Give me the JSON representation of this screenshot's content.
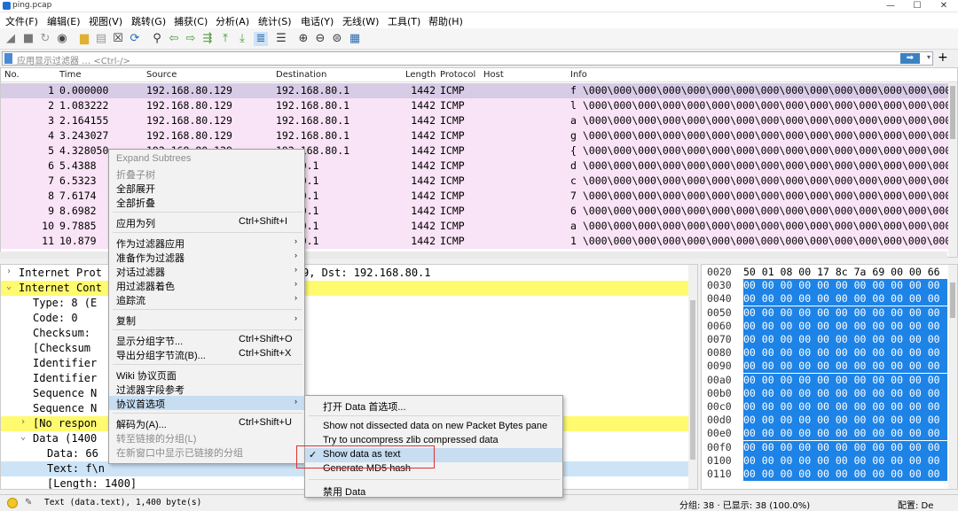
{
  "window": {
    "title": "ping.pcap",
    "minimize": "—",
    "maximize": "☐",
    "close": "✕"
  },
  "menubar": [
    "文件(F)",
    "编辑(E)",
    "视图(V)",
    "跳转(G)",
    "捕获(C)",
    "分析(A)",
    "统计(S)",
    "电话(Y)",
    "无线(W)",
    "工具(T)",
    "帮助(H)"
  ],
  "toolbar_icons": [
    "shark-fin-start-icon",
    "stop-icon",
    "restart-icon",
    "options-icon",
    "open-folder-icon",
    "save-file-icon",
    "close-file-icon",
    "reload-icon",
    "find-icon",
    "back-arrow-icon",
    "forward-arrow-icon",
    "goto-packet-icon",
    "first-packet-icon",
    "last-packet-icon",
    "autoscroll-icon",
    "colorize-icon",
    "zoom-in-icon",
    "zoom-out-icon",
    "zoom-normal-icon",
    "resize-columns-icon"
  ],
  "filter": {
    "placeholder": "应用显示过滤器 … <Ctrl-/>",
    "apply_arrow": "➡",
    "dropdown": "▾",
    "add": "+"
  },
  "packet_list": {
    "columns": [
      "No.",
      "Time",
      "Source",
      "Destination",
      "Length",
      "Protocol",
      "Host",
      "Info"
    ],
    "rows": [
      {
        "no": "1",
        "time": "0.000000",
        "src": "192.168.80.129",
        "dst": "192.168.80.1",
        "len": "1442",
        "proto": "ICMP",
        "info": "f \\000\\000\\000\\000\\000\\000\\000\\000\\000\\000\\000\\000\\000\\000\\000\\000\\000\\000\\000\\000\\000\\000"
      },
      {
        "no": "2",
        "time": "1.083222",
        "src": "192.168.80.129",
        "dst": "192.168.80.1",
        "len": "1442",
        "proto": "ICMP",
        "info": "l \\000\\000\\000\\000\\000\\000\\000\\000\\000\\000\\000\\000\\000\\000\\000\\000\\000\\000\\000\\000\\000\\000"
      },
      {
        "no": "3",
        "time": "2.164155",
        "src": "192.168.80.129",
        "dst": "192.168.80.1",
        "len": "1442",
        "proto": "ICMP",
        "info": "a \\000\\000\\000\\000\\000\\000\\000\\000\\000\\000\\000\\000\\000\\000\\000\\000\\000\\000\\000\\000\\000\\000"
      },
      {
        "no": "4",
        "time": "3.243027",
        "src": "192.168.80.129",
        "dst": "192.168.80.1",
        "len": "1442",
        "proto": "ICMP",
        "info": "g \\000\\000\\000\\000\\000\\000\\000\\000\\000\\000\\000\\000\\000\\000\\000\\000\\000\\000\\000\\000\\000\\000"
      },
      {
        "no": "5",
        "time": "4.328050",
        "src": "192.168.80.129",
        "dst": "192.168.80.1",
        "len": "1442",
        "proto": "ICMP",
        "info": "{ \\000\\000\\000\\000\\000\\000\\000\\000\\000\\000\\000\\000\\000\\000\\000\\000\\000\\000\\000\\000\\000\\000"
      },
      {
        "no": "6",
        "time": "5.4388",
        "src": "",
        "dst": "58.80.1",
        "len": "1442",
        "proto": "ICMP",
        "info": "d \\000\\000\\000\\000\\000\\000\\000\\000\\000\\000\\000\\000\\000\\000\\000\\000\\000\\000\\000\\000\\000\\000"
      },
      {
        "no": "7",
        "time": "6.5323",
        "src": "",
        "dst": "58.80.1",
        "len": "1442",
        "proto": "ICMP",
        "info": "c \\000\\000\\000\\000\\000\\000\\000\\000\\000\\000\\000\\000\\000\\000\\000\\000\\000\\000\\000\\000\\000\\000"
      },
      {
        "no": "8",
        "time": "7.6174",
        "src": "",
        "dst": "58.80.1",
        "len": "1442",
        "proto": "ICMP",
        "info": "7 \\000\\000\\000\\000\\000\\000\\000\\000\\000\\000\\000\\000\\000\\000\\000\\000\\000\\000\\000\\000\\000\\000"
      },
      {
        "no": "9",
        "time": "8.6982",
        "src": "",
        "dst": "58.80.1",
        "len": "1442",
        "proto": "ICMP",
        "info": "6 \\000\\000\\000\\000\\000\\000\\000\\000\\000\\000\\000\\000\\000\\000\\000\\000\\000\\000\\000\\000\\000\\000"
      },
      {
        "no": "10",
        "time": "9.7885",
        "src": "",
        "dst": "58.80.1",
        "len": "1442",
        "proto": "ICMP",
        "info": "a \\000\\000\\000\\000\\000\\000\\000\\000\\000\\000\\000\\000\\000\\000\\000\\000\\000\\000\\000\\000\\000\\000"
      },
      {
        "no": "11",
        "time": "10.879",
        "src": "",
        "dst": "58.80.1",
        "len": "1442",
        "proto": "ICMP",
        "info": "1 \\000\\000\\000\\000\\000\\000\\000\\000\\000\\000\\000\\000\\000\\000\\000\\000\\000\\000\\000\\000\\000\\000"
      }
    ]
  },
  "details": {
    "rows": [
      {
        "arrow": "›",
        "text": "Internet Prot",
        "extra": "9, Dst: 192.168.80.1"
      },
      {
        "arrow": "⌄",
        "text": "Internet Cont",
        "extra": ""
      },
      {
        "arrow": "",
        "text": "Type: 8 (E",
        "extra": ""
      },
      {
        "arrow": "",
        "text": "Code: 0",
        "extra": ""
      },
      {
        "arrow": "",
        "text": "Checksum:",
        "extra": ""
      },
      {
        "arrow": "",
        "text": "[Checksum",
        "extra": ""
      },
      {
        "arrow": "",
        "text": "Identifier",
        "extra": ""
      },
      {
        "arrow": "",
        "text": "Identifier",
        "extra": ""
      },
      {
        "arrow": "",
        "text": "Sequence N",
        "extra": ""
      },
      {
        "arrow": "",
        "text": "Sequence N",
        "extra": ""
      },
      {
        "arrow": "›",
        "text": "[No respon",
        "extra": ""
      },
      {
        "arrow": "⌄",
        "text": "Data (1400",
        "extra": ""
      },
      {
        "arrow": "",
        "text": "Data: 66",
        "extra": ""
      },
      {
        "arrow": "",
        "text": "Text: f\\n",
        "extra": ""
      },
      {
        "arrow": "",
        "text": "[Length: 1400]",
        "extra": ""
      }
    ]
  },
  "bytes": {
    "rows": [
      {
        "off": "0020",
        "hex": "50 01 08 00 17 8c 7a 69  00 00 66"
      },
      {
        "off": "0030",
        "hex": "00 00 00 00 00 00 00 00  00 00 00"
      },
      {
        "off": "0040",
        "hex": "00 00 00 00 00 00 00 00  00 00 00"
      },
      {
        "off": "0050",
        "hex": "00 00 00 00 00 00 00 00  00 00 00"
      },
      {
        "off": "0060",
        "hex": "00 00 00 00 00 00 00 00  00 00 00"
      },
      {
        "off": "0070",
        "hex": "00 00 00 00 00 00 00 00  00 00 00"
      },
      {
        "off": "0080",
        "hex": "00 00 00 00 00 00 00 00  00 00 00"
      },
      {
        "off": "0090",
        "hex": "00 00 00 00 00 00 00 00  00 00 00"
      },
      {
        "off": "00a0",
        "hex": "00 00 00 00 00 00 00 00  00 00 00"
      },
      {
        "off": "00b0",
        "hex": "00 00 00 00 00 00 00 00  00 00 00"
      },
      {
        "off": "00c0",
        "hex": "00 00 00 00 00 00 00 00  00 00 00"
      },
      {
        "off": "00d0",
        "hex": "00 00 00 00 00 00 00 00  00 00 00"
      },
      {
        "off": "00e0",
        "hex": "00 00 00 00 00 00 00 00  00 00 00"
      },
      {
        "off": "00f0",
        "hex": "00 00 00 00 00 00 00 00  00 00 00"
      },
      {
        "off": "0100",
        "hex": "00 00 00 00 00 00 00 00  00 00 00"
      },
      {
        "off": "0110",
        "hex": "00 00 00 00 00 00 00 00  00 00 00"
      }
    ]
  },
  "context_menu": {
    "items": [
      {
        "label": "Expand Subtrees",
        "disabled": true
      },
      {
        "label": "折叠子树",
        "disabled": true
      },
      {
        "label": "全部展开"
      },
      {
        "label": "全部折叠"
      },
      {
        "sep": true
      },
      {
        "label": "应用为列",
        "shortcut": "Ctrl+Shift+I"
      },
      {
        "sep": true
      },
      {
        "label": "作为过滤器应用",
        "submenu": true
      },
      {
        "label": "准备作为过滤器",
        "submenu": true
      },
      {
        "label": "对话过滤器",
        "submenu": true
      },
      {
        "label": "用过滤器着色",
        "submenu": true
      },
      {
        "label": "追踪流",
        "submenu": true
      },
      {
        "sep": true
      },
      {
        "label": "复制",
        "submenu": true
      },
      {
        "sep": true
      },
      {
        "label": "显示分组字节...",
        "shortcut": "Ctrl+Shift+O"
      },
      {
        "label": "导出分组字节流(B)...",
        "shortcut": "Ctrl+Shift+X"
      },
      {
        "sep": true
      },
      {
        "label": "Wiki 协议页面"
      },
      {
        "label": "过滤器字段参考"
      },
      {
        "label": "协议首选项",
        "submenu": true,
        "active": true
      },
      {
        "sep": true
      },
      {
        "label": "解码为(A)...",
        "shortcut": "Ctrl+Shift+U"
      },
      {
        "label": "转至链接的分组(L)",
        "disabled": true
      },
      {
        "label": "在新窗口中显示已链接的分组",
        "disabled": true
      }
    ]
  },
  "submenu": {
    "items": [
      {
        "label": "打开 Data 首选项..."
      },
      {
        "sep": true
      },
      {
        "label": "Show not dissected data on new Packet Bytes pane"
      },
      {
        "label": "Try to uncompress zlib compressed data"
      },
      {
        "label": "Show data as text",
        "checked": true,
        "active": true
      },
      {
        "label": "Generate MD5 hash"
      },
      {
        "sep": true
      },
      {
        "label": "禁用 Data"
      }
    ]
  },
  "status": {
    "field": "Text (data.text), 1,400 byte(s)",
    "packets": "分组: 38 · 已显示: 38 (100.0%)",
    "profile": "配置: De"
  },
  "colors": {
    "row_bg": "#f9e3f6",
    "row_selected": "#d7cbe6",
    "highlight_yellow": "#fffa6e",
    "bytes_selected": "#1e83e6",
    "menu_active": "#c6ddf2",
    "callout_red": "#e03030"
  }
}
